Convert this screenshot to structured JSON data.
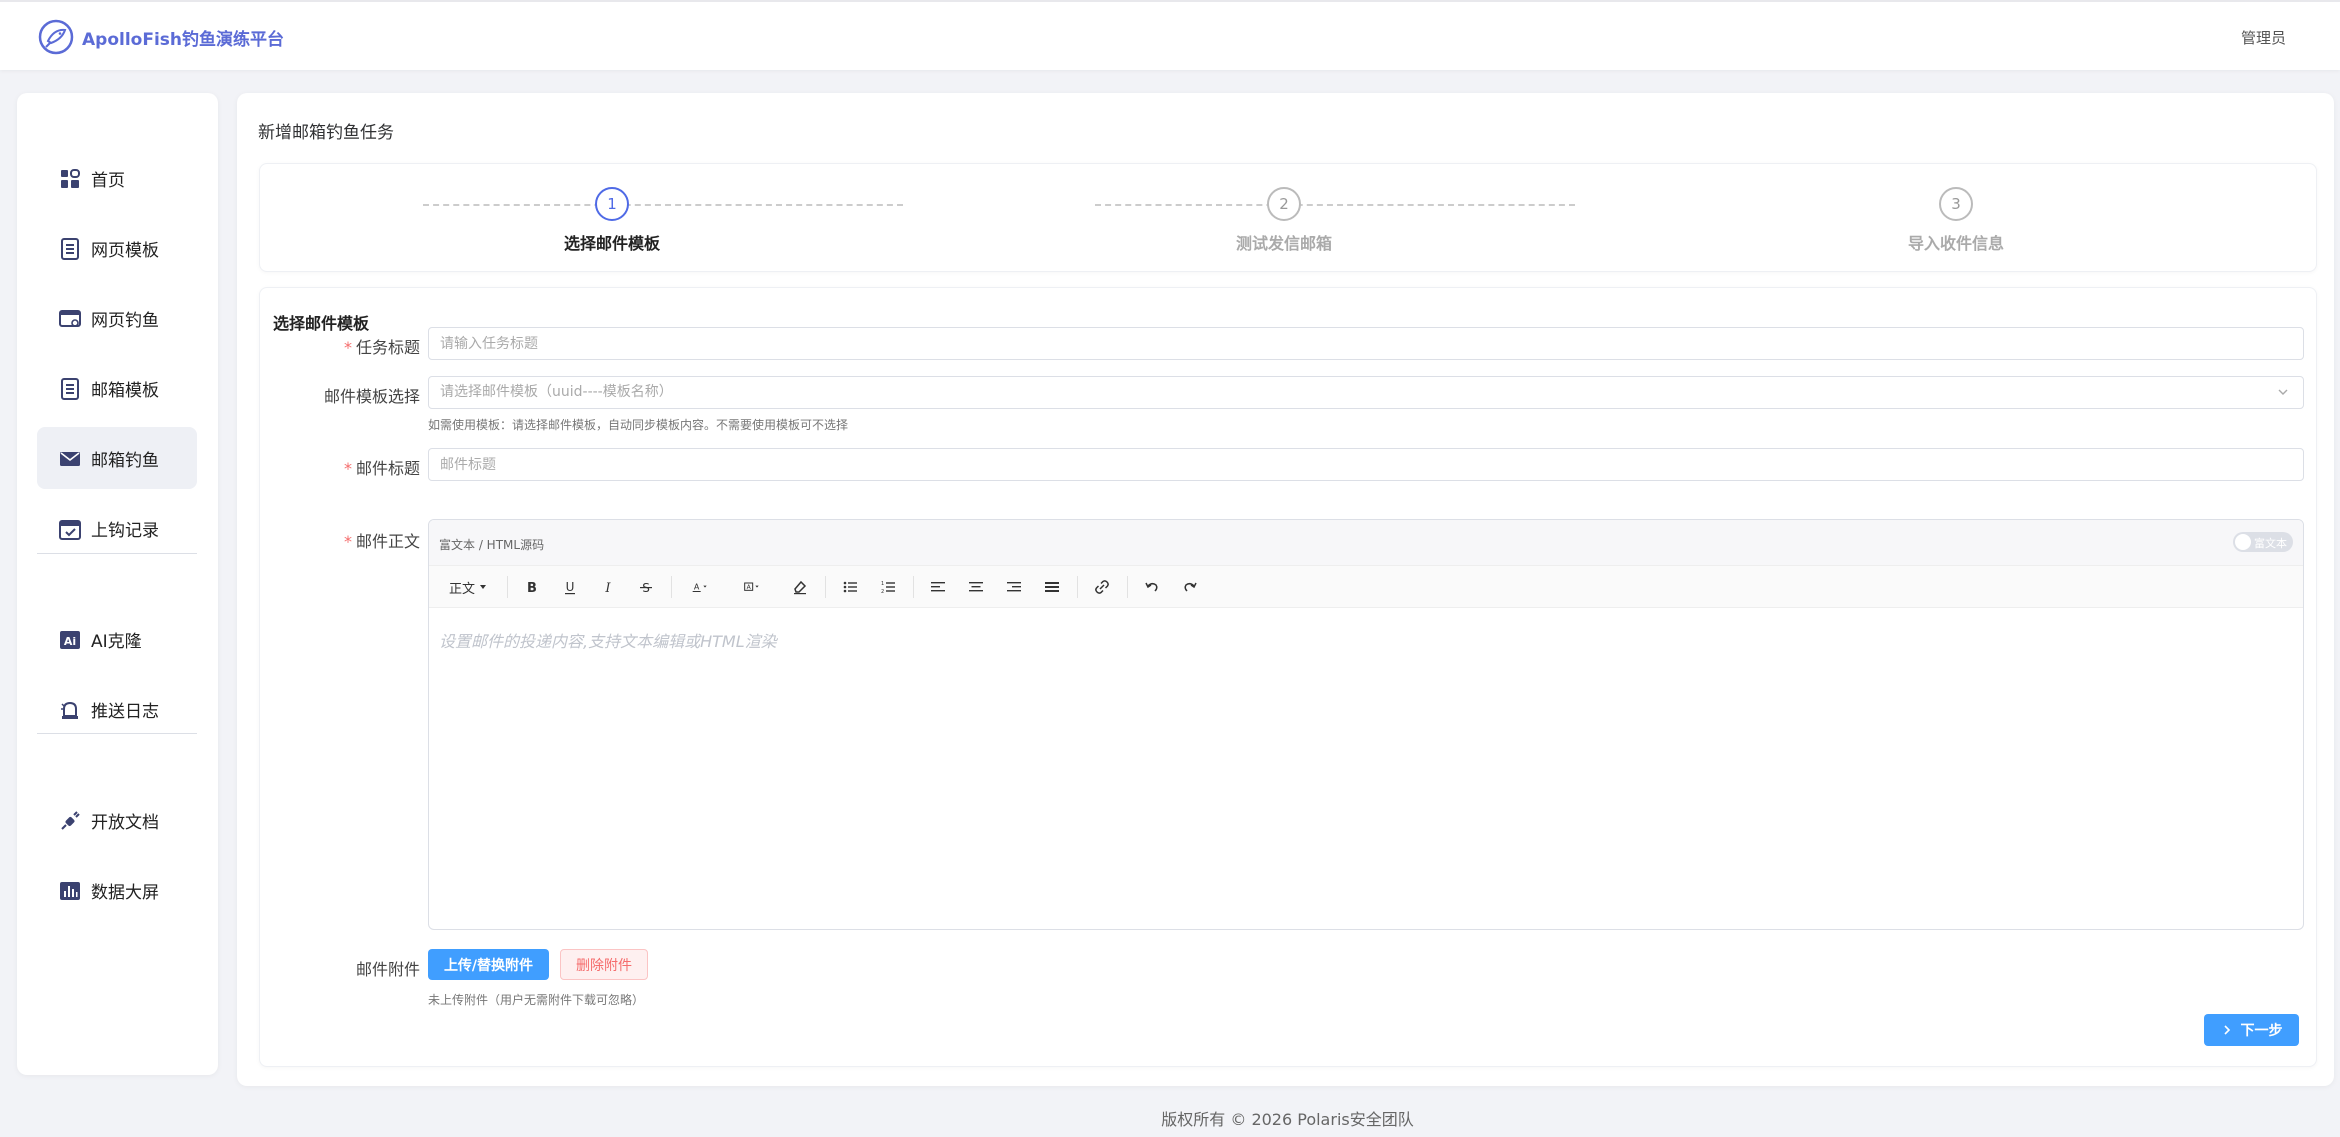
{
  "header": {
    "brand_title": "ApolloFish钓鱼演练平台",
    "user_name": "管理员",
    "brand_color": "#5b6bd6"
  },
  "sidebar": {
    "items": [
      {
        "label": "首页",
        "icon": "dashboard-icon"
      },
      {
        "label": "网页模板",
        "icon": "document-icon"
      },
      {
        "label": "网页钓鱼",
        "icon": "browser-window-icon"
      },
      {
        "label": "邮箱模板",
        "icon": "list-document-icon"
      },
      {
        "label": "邮箱钓鱼",
        "icon": "mail-icon",
        "active": true
      },
      {
        "label": "上钩记录",
        "icon": "calendar-check-icon"
      },
      {
        "label": "AI克隆",
        "icon": "ai-icon"
      },
      {
        "label": "推送日志",
        "icon": "bell-icon"
      },
      {
        "label": "开放文档",
        "icon": "plug-icon"
      },
      {
        "label": "数据大屏",
        "icon": "chart-icon"
      }
    ]
  },
  "main": {
    "page_title": "新增邮箱钓鱼任务",
    "steps": [
      {
        "number": "1",
        "label": "选择邮件模板",
        "active": true
      },
      {
        "number": "2",
        "label": "测试发信邮箱",
        "active": false
      },
      {
        "number": "3",
        "label": "导入收件信息",
        "active": false
      }
    ],
    "form": {
      "section_title": "选择邮件模板",
      "task_title_label": "任务标题",
      "task_title_placeholder": "请输入任务标题",
      "template_label": "邮件模板选择",
      "template_placeholder": "请选择邮件模板（uuid----模板名称）",
      "template_hint": "如需使用模板：请选择邮件模板，自动同步模板内容。不需要使用模板可不选择",
      "subject_label": "邮件标题",
      "subject_placeholder": "邮件标题",
      "body_label": "邮件正文",
      "editor_mode_label": "富文本 / HTML源码",
      "toggle_label": "富文本",
      "toolbar_paragraph": "正文",
      "editor_placeholder": "设置邮件的投递内容,支持文本编辑或HTML渲染",
      "attachment_label": "邮件附件",
      "upload_button": "上传/替换附件",
      "delete_button": "删除附件",
      "attachment_hint": "未上传附件（用户无需附件下载可忽略）",
      "next_button": "下一步"
    }
  },
  "footer": {
    "copyright": "版权所有 © 2026 Polaris安全团队"
  },
  "colors": {
    "primary": "#409eff",
    "step_active": "#4f6ae6",
    "danger": "#f56c6c",
    "nav_icon": "#3b4270"
  }
}
